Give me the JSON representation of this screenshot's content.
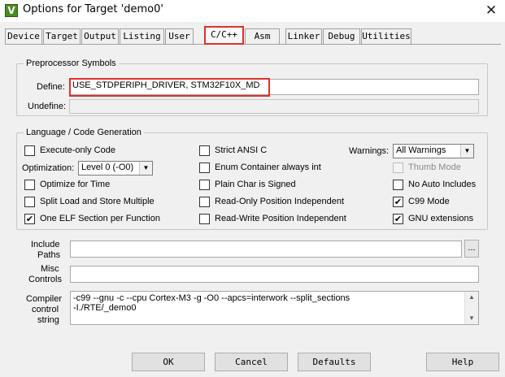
{
  "window": {
    "title": "Options for Target 'demo0'",
    "app_icon_glyph": "V",
    "close_glyph": "✕"
  },
  "tabs": [
    {
      "label": "Device",
      "active": false
    },
    {
      "label": "Target",
      "active": false
    },
    {
      "label": "Output",
      "active": false
    },
    {
      "label": "Listing",
      "active": false
    },
    {
      "label": "User",
      "active": false
    },
    {
      "label": "C/C++",
      "active": true
    },
    {
      "label": "Asm",
      "active": false
    },
    {
      "label": "Linker",
      "active": false
    },
    {
      "label": "Debug",
      "active": false
    },
    {
      "label": "Utilities",
      "active": false
    }
  ],
  "preprocessor": {
    "group_title": "Preprocessor Symbols",
    "define_label": "Define:",
    "define_value": "USE_STDPERIPH_DRIVER, STM32F10X_MD",
    "undefine_label": "Undefine:",
    "undefine_value": ""
  },
  "language": {
    "group_title": "Language / Code Generation",
    "execute_only": {
      "label": "Execute-only Code",
      "checked": false
    },
    "optimization_label": "Optimization:",
    "optimization_value": "Level 0 (-O0)",
    "optimize_time": {
      "label": "Optimize for Time",
      "checked": false
    },
    "split_load": {
      "label": "Split Load and Store Multiple",
      "checked": false
    },
    "one_elf": {
      "label": "One ELF Section per Function",
      "checked": true
    },
    "strict_ansi": {
      "label": "Strict ANSI C",
      "checked": false
    },
    "enum_container": {
      "label": "Enum Container always int",
      "checked": false
    },
    "plain_char": {
      "label": "Plain Char is Signed",
      "checked": false
    },
    "ro_pi": {
      "label": "Read-Only Position Independent",
      "checked": false
    },
    "rw_pi": {
      "label": "Read-Write Position Independent",
      "checked": false
    },
    "warnings_label": "Warnings:",
    "warnings_value": "All Warnings",
    "thumb_mode": {
      "label": "Thumb Mode",
      "checked": false,
      "disabled": true
    },
    "no_auto_includes": {
      "label": "No Auto Includes",
      "checked": false
    },
    "c99_mode": {
      "label": "C99 Mode",
      "checked": true
    },
    "gnu_extensions": {
      "label": "GNU extensions",
      "checked": true
    }
  },
  "include_paths": {
    "label_line1": "Include",
    "label_line2": "Paths",
    "value": "",
    "browse_label": "..."
  },
  "misc_controls": {
    "label_line1": "Misc",
    "label_line2": "Controls",
    "value": ""
  },
  "compiler_control": {
    "label_line1": "Compiler",
    "label_line2": "control",
    "label_line3": "string",
    "line1": "-c99 --gnu -c --cpu Cortex-M3 -g -O0 --apcs=interwork --split_sections",
    "line2": "-I./RTE/_demo0"
  },
  "buttons": {
    "ok": "OK",
    "cancel": "Cancel",
    "defaults": "Defaults",
    "help": "Help"
  },
  "check_glyph": "✔",
  "colors": {
    "highlight": "#e0302a",
    "dialog_bg": "#f0f0f0"
  }
}
